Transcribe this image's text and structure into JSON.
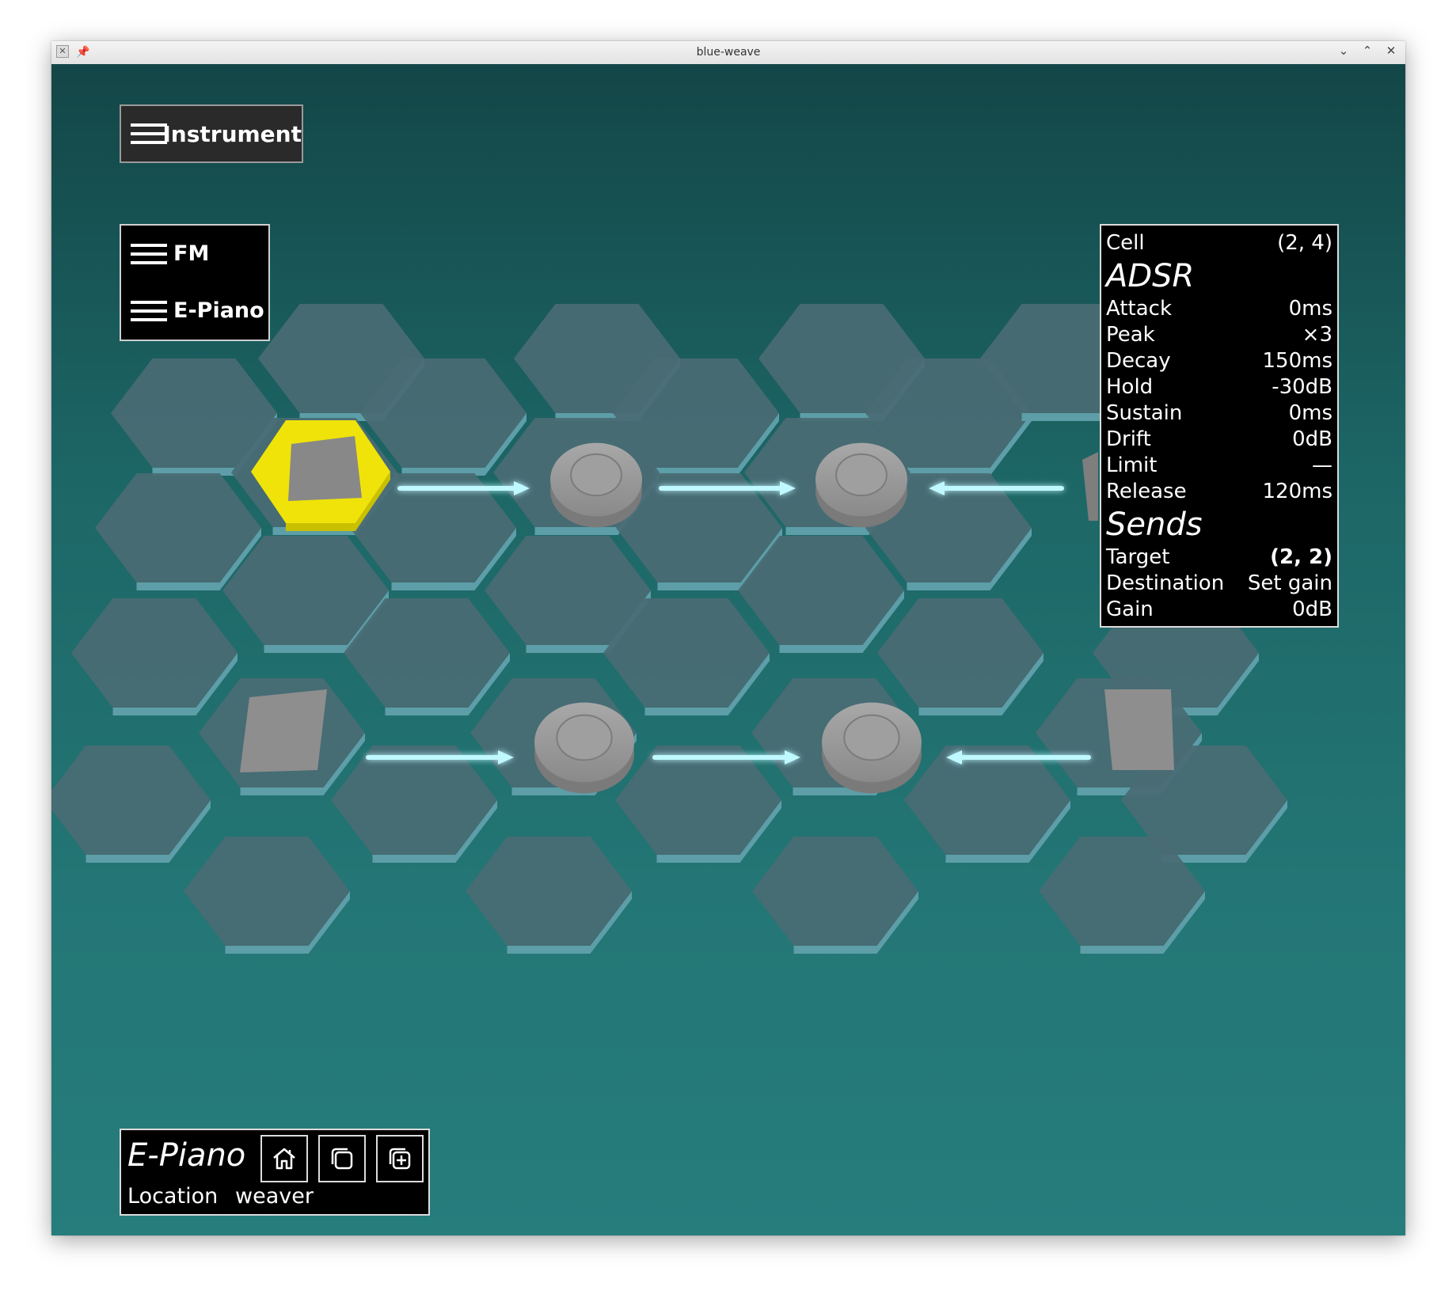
{
  "window": {
    "title": "blue-weave",
    "controls": [
      "minimize-icon",
      "maximize-icon",
      "close-icon"
    ]
  },
  "instrument_menu": {
    "label": "Instrument"
  },
  "menu_group": {
    "items": [
      {
        "label": "FM"
      },
      {
        "label": "E-Piano"
      }
    ]
  },
  "info_panel": {
    "cell_label": "Cell",
    "cell_value": "(2, 4)",
    "adsr_heading": "ADSR",
    "adsr": [
      {
        "label": "Attack",
        "value": "0ms"
      },
      {
        "label": "Peak",
        "value": "×3"
      },
      {
        "label": "Decay",
        "value": "150ms"
      },
      {
        "label": "Hold",
        "value": "-30dB"
      },
      {
        "label": "Sustain",
        "value": "0ms"
      },
      {
        "label": "Drift",
        "value": "0dB"
      },
      {
        "label": "Limit",
        "value": "—"
      },
      {
        "label": "Release",
        "value": "120ms"
      }
    ],
    "sends_heading": "Sends",
    "sends": [
      {
        "label": "Target",
        "value": "(2, 2)"
      },
      {
        "label": "Destination",
        "value": "Set gain"
      },
      {
        "label": "Gain",
        "value": "0dB"
      }
    ]
  },
  "bottom_panel": {
    "title": "E-Piano",
    "buttons": [
      "home-icon",
      "copy-icon",
      "add-copy-icon"
    ],
    "location_label": "Location",
    "location_value": "weaver"
  },
  "colors": {
    "background_top": "#134647",
    "background_bottom": "#267d7c",
    "hex_tile": "#4a6b74",
    "hex_edge": "#5d9ea8",
    "selected": "#ffee00",
    "arrow": "#bff8ff"
  }
}
